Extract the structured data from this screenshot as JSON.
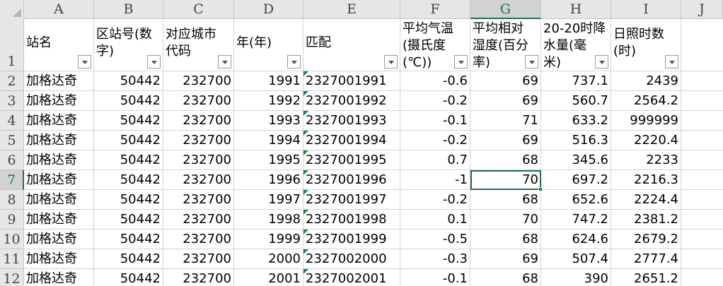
{
  "columns": [
    "A",
    "B",
    "C",
    "D",
    "E",
    "F",
    "G",
    "H",
    "I",
    "J"
  ],
  "row_numbers": [
    "1",
    "2",
    "3",
    "4",
    "5",
    "6",
    "7",
    "8",
    "9",
    "10",
    "11",
    "12"
  ],
  "headers": {
    "A": "站名",
    "B": "区站号(数\n字)",
    "C": "对应城市\n代码",
    "D": "年(年)",
    "E": "匹配",
    "F": "平均气温\n(摄氏度\n(℃))",
    "G": "平均相对\n湿度(百分\n率)",
    "H": "20-20时降\n水量(毫\n米)",
    "I": "日照时数\n(时)"
  },
  "rows": [
    {
      "A": "加格达奇",
      "B": "50442",
      "C": "232700",
      "D": "1991",
      "E": "2327001991",
      "F": "-0.6",
      "G": "69",
      "H": "737.1",
      "I": "2439"
    },
    {
      "A": "加格达奇",
      "B": "50442",
      "C": "232700",
      "D": "1992",
      "E": "2327001992",
      "F": "-0.2",
      "G": "69",
      "H": "560.7",
      "I": "2564.2"
    },
    {
      "A": "加格达奇",
      "B": "50442",
      "C": "232700",
      "D": "1993",
      "E": "2327001993",
      "F": "-0.1",
      "G": "71",
      "H": "633.2",
      "I": "999999"
    },
    {
      "A": "加格达奇",
      "B": "50442",
      "C": "232700",
      "D": "1994",
      "E": "2327001994",
      "F": "-0.2",
      "G": "69",
      "H": "516.3",
      "I": "2220.4"
    },
    {
      "A": "加格达奇",
      "B": "50442",
      "C": "232700",
      "D": "1995",
      "E": "2327001995",
      "F": "0.7",
      "G": "68",
      "H": "345.6",
      "I": "2233"
    },
    {
      "A": "加格达奇",
      "B": "50442",
      "C": "232700",
      "D": "1996",
      "E": "2327001996",
      "F": "-1",
      "G": "70",
      "H": "697.2",
      "I": "2216.3"
    },
    {
      "A": "加格达奇",
      "B": "50442",
      "C": "232700",
      "D": "1997",
      "E": "2327001997",
      "F": "-0.2",
      "G": "68",
      "H": "652.6",
      "I": "2224.4"
    },
    {
      "A": "加格达奇",
      "B": "50442",
      "C": "232700",
      "D": "1998",
      "E": "2327001998",
      "F": "0.1",
      "G": "70",
      "H": "747.2",
      "I": "2381.2"
    },
    {
      "A": "加格达奇",
      "B": "50442",
      "C": "232700",
      "D": "1999",
      "E": "2327001999",
      "F": "-0.5",
      "G": "68",
      "H": "624.6",
      "I": "2679.2"
    },
    {
      "A": "加格达奇",
      "B": "50442",
      "C": "232700",
      "D": "2000",
      "E": "2327002000",
      "F": "-0.3",
      "G": "69",
      "H": "507.4",
      "I": "2777.4"
    },
    {
      "A": "加格达奇",
      "B": "50442",
      "C": "232700",
      "D": "2001",
      "E": "2327002001",
      "F": "-0.1",
      "G": "68",
      "H": "390",
      "I": "2651.2"
    }
  ],
  "selection": {
    "column": "G",
    "row": "7"
  },
  "colors": {
    "accent": "#217346",
    "error_indicator": "#1e8a3a",
    "header_bg": "#e6e6e6"
  }
}
